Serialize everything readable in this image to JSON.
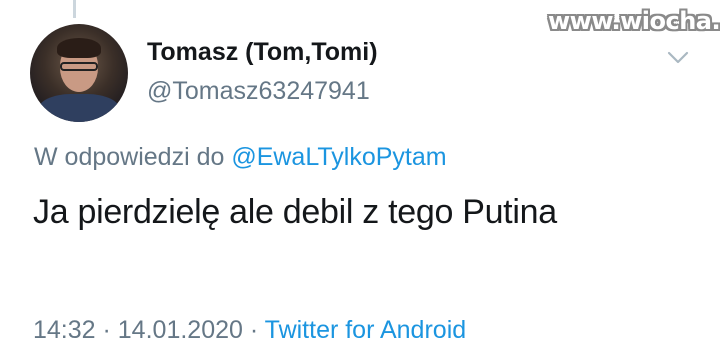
{
  "watermark": "www.wiocha.pl",
  "user": {
    "display_name": "Tomasz (Tom,Tomi)",
    "handle": "@Tomasz63247941"
  },
  "reply": {
    "prefix": "W odpowiedzi do ",
    "mention": "@EwaLTylkoPytam"
  },
  "tweet": {
    "text": "Ja pierdzielę ale debil z tego Putina"
  },
  "meta": {
    "time": "14:32",
    "sep1": " · ",
    "date": "14.01.2020",
    "sep2": " · ",
    "source": "Twitter for Android"
  },
  "icons": {
    "menu": "chevron-down-icon"
  },
  "colors": {
    "link": "#1b95e0",
    "secondary_text": "#657786",
    "primary_text": "#14171a"
  }
}
